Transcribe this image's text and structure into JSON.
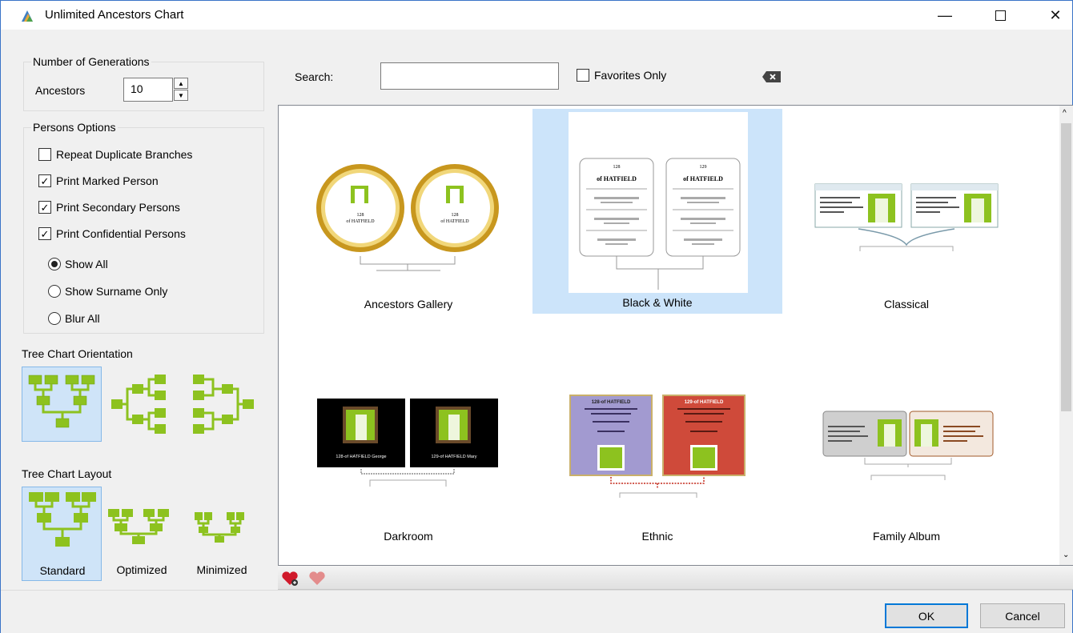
{
  "window": {
    "title": "Unlimited Ancestors Chart"
  },
  "generations": {
    "group_title": "Number of Generations",
    "ancestors_label": "Ancestors",
    "ancestors_value": "10"
  },
  "persons_options": {
    "group_title": "Persons Options",
    "checks": [
      {
        "label": "Repeat Duplicate Branches",
        "checked": false
      },
      {
        "label": "Print Marked Person",
        "checked": true
      },
      {
        "label": "Print Secondary Persons",
        "checked": true
      },
      {
        "label": "Print Confidential Persons",
        "checked": true
      }
    ],
    "radios": [
      {
        "label": "Show All",
        "selected": true
      },
      {
        "label": "Show Surname Only",
        "selected": false
      },
      {
        "label": "Blur All",
        "selected": false
      }
    ]
  },
  "orientation": {
    "title": "Tree Chart Orientation",
    "selected": "top-down"
  },
  "layout": {
    "title": "Tree Chart Layout",
    "options": [
      "Standard",
      "Optimized",
      "Minimized"
    ],
    "selected": "Standard"
  },
  "search": {
    "label": "Search:",
    "value": "",
    "favorites_label": "Favorites Only",
    "favorites_checked": false
  },
  "gallery": {
    "items": [
      "Ancestors Gallery",
      "Black & White",
      "Classical",
      "Darkroom",
      "Ethnic",
      "Family Album"
    ],
    "selected": "Black & White",
    "thumb_text": {
      "bw_left_num": "128",
      "bw_right_num": "129",
      "bw_surname": "of HATFIELD",
      "darkroom_left": "128-of HATFIELD George",
      "darkroom_right": "129-of HATFIELD Mary",
      "ethnic_left": "128-of HATFIELD",
      "ethnic_right": "129-of HATFIELD",
      "gallery_num": "128",
      "gallery_surname": "of HATFIELD"
    }
  },
  "footer": {
    "ok_label": "OK",
    "cancel_label": "Cancel"
  },
  "colors": {
    "accent": "#0078d7",
    "selection": "#cce4fa",
    "tree_green": "#8dc21f"
  }
}
